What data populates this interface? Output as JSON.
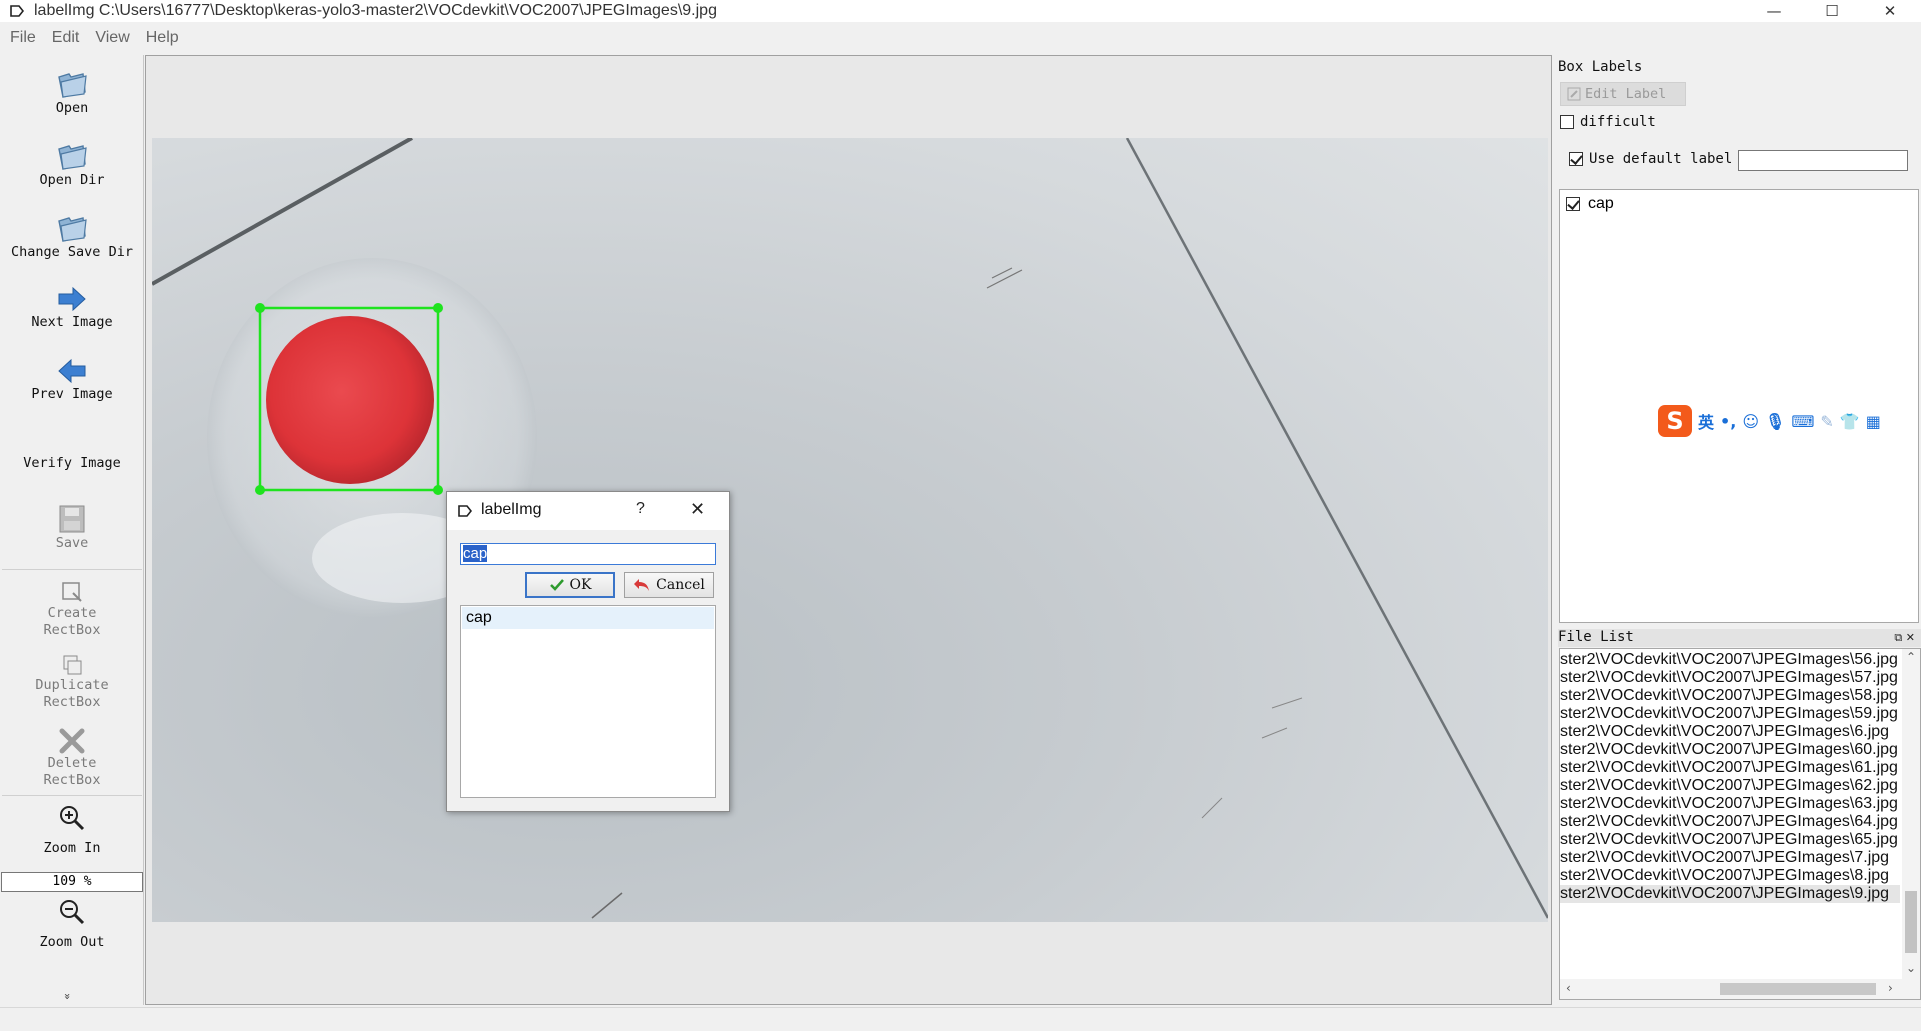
{
  "window": {
    "title": "labelImg C:\\Users\\16777\\Desktop\\keras-yolo3-master2\\VOCdevkit\\VOC2007\\JPEGImages\\9.jpg",
    "minimize": "—",
    "maximize": "☐",
    "close": "✕"
  },
  "menu": [
    "File",
    "Edit",
    "View",
    "Help"
  ],
  "toolbar": {
    "open": "Open",
    "open_dir": "Open Dir",
    "change_save_dir": "Change Save Dir",
    "next_image": "Next Image",
    "prev_image": "Prev Image",
    "verify_image": "Verify Image",
    "save": "Save",
    "create_rectbox_1": "Create",
    "create_rectbox_2": "RectBox",
    "duplicate_rectbox_1": "Duplicate",
    "duplicate_rectbox_2": "RectBox",
    "delete_rectbox_1": "Delete",
    "delete_rectbox_2": "RectBox",
    "zoom_in": "Zoom In",
    "zoom_value": "109 %",
    "zoom_out": "Zoom Out",
    "more": "»"
  },
  "box_labels": {
    "title": "Box Labels",
    "edit_label": "Edit Label",
    "difficult": "difficult",
    "difficult_checked": false,
    "use_default_label": "Use default label",
    "use_default_checked": true,
    "default_label_value": "",
    "items": [
      {
        "label": "cap",
        "checked": true
      }
    ]
  },
  "ime": {
    "logo": "S",
    "lang": "英",
    "icons": [
      "punctuation-icon",
      "emoji-icon",
      "microphone-icon",
      "keyboard-icon",
      "skin-icon",
      "shirt-icon",
      "grid-icon"
    ]
  },
  "file_list": {
    "title": "File List",
    "files": [
      "ster2\\VOCdevkit\\VOC2007\\JPEGImages\\56.jpg",
      "ster2\\VOCdevkit\\VOC2007\\JPEGImages\\57.jpg",
      "ster2\\VOCdevkit\\VOC2007\\JPEGImages\\58.jpg",
      "ster2\\VOCdevkit\\VOC2007\\JPEGImages\\59.jpg",
      "ster2\\VOCdevkit\\VOC2007\\JPEGImages\\6.jpg",
      "ster2\\VOCdevkit\\VOC2007\\JPEGImages\\60.jpg",
      "ster2\\VOCdevkit\\VOC2007\\JPEGImages\\61.jpg",
      "ster2\\VOCdevkit\\VOC2007\\JPEGImages\\62.jpg",
      "ster2\\VOCdevkit\\VOC2007\\JPEGImages\\63.jpg",
      "ster2\\VOCdevkit\\VOC2007\\JPEGImages\\64.jpg",
      "ster2\\VOCdevkit\\VOC2007\\JPEGImages\\65.jpg",
      "ster2\\VOCdevkit\\VOC2007\\JPEGImages\\7.jpg",
      "ster2\\VOCdevkit\\VOC2007\\JPEGImages\\8.jpg",
      "ster2\\VOCdevkit\\VOC2007\\JPEGImages\\9.jpg"
    ],
    "selected": "ster2\\VOCdevkit\\VOC2007\\JPEGImages\\9.jpg"
  },
  "dialog": {
    "title": "labelImg",
    "help": "?",
    "close": "✕",
    "input_value": "cap",
    "ok": "OK",
    "cancel": "Cancel",
    "list": [
      "cap"
    ]
  },
  "colors": {
    "bbox": "#1fe31f",
    "cap": "#e13a3f",
    "selection": "#2a62c9",
    "ime_logo": "#f35a1b"
  }
}
